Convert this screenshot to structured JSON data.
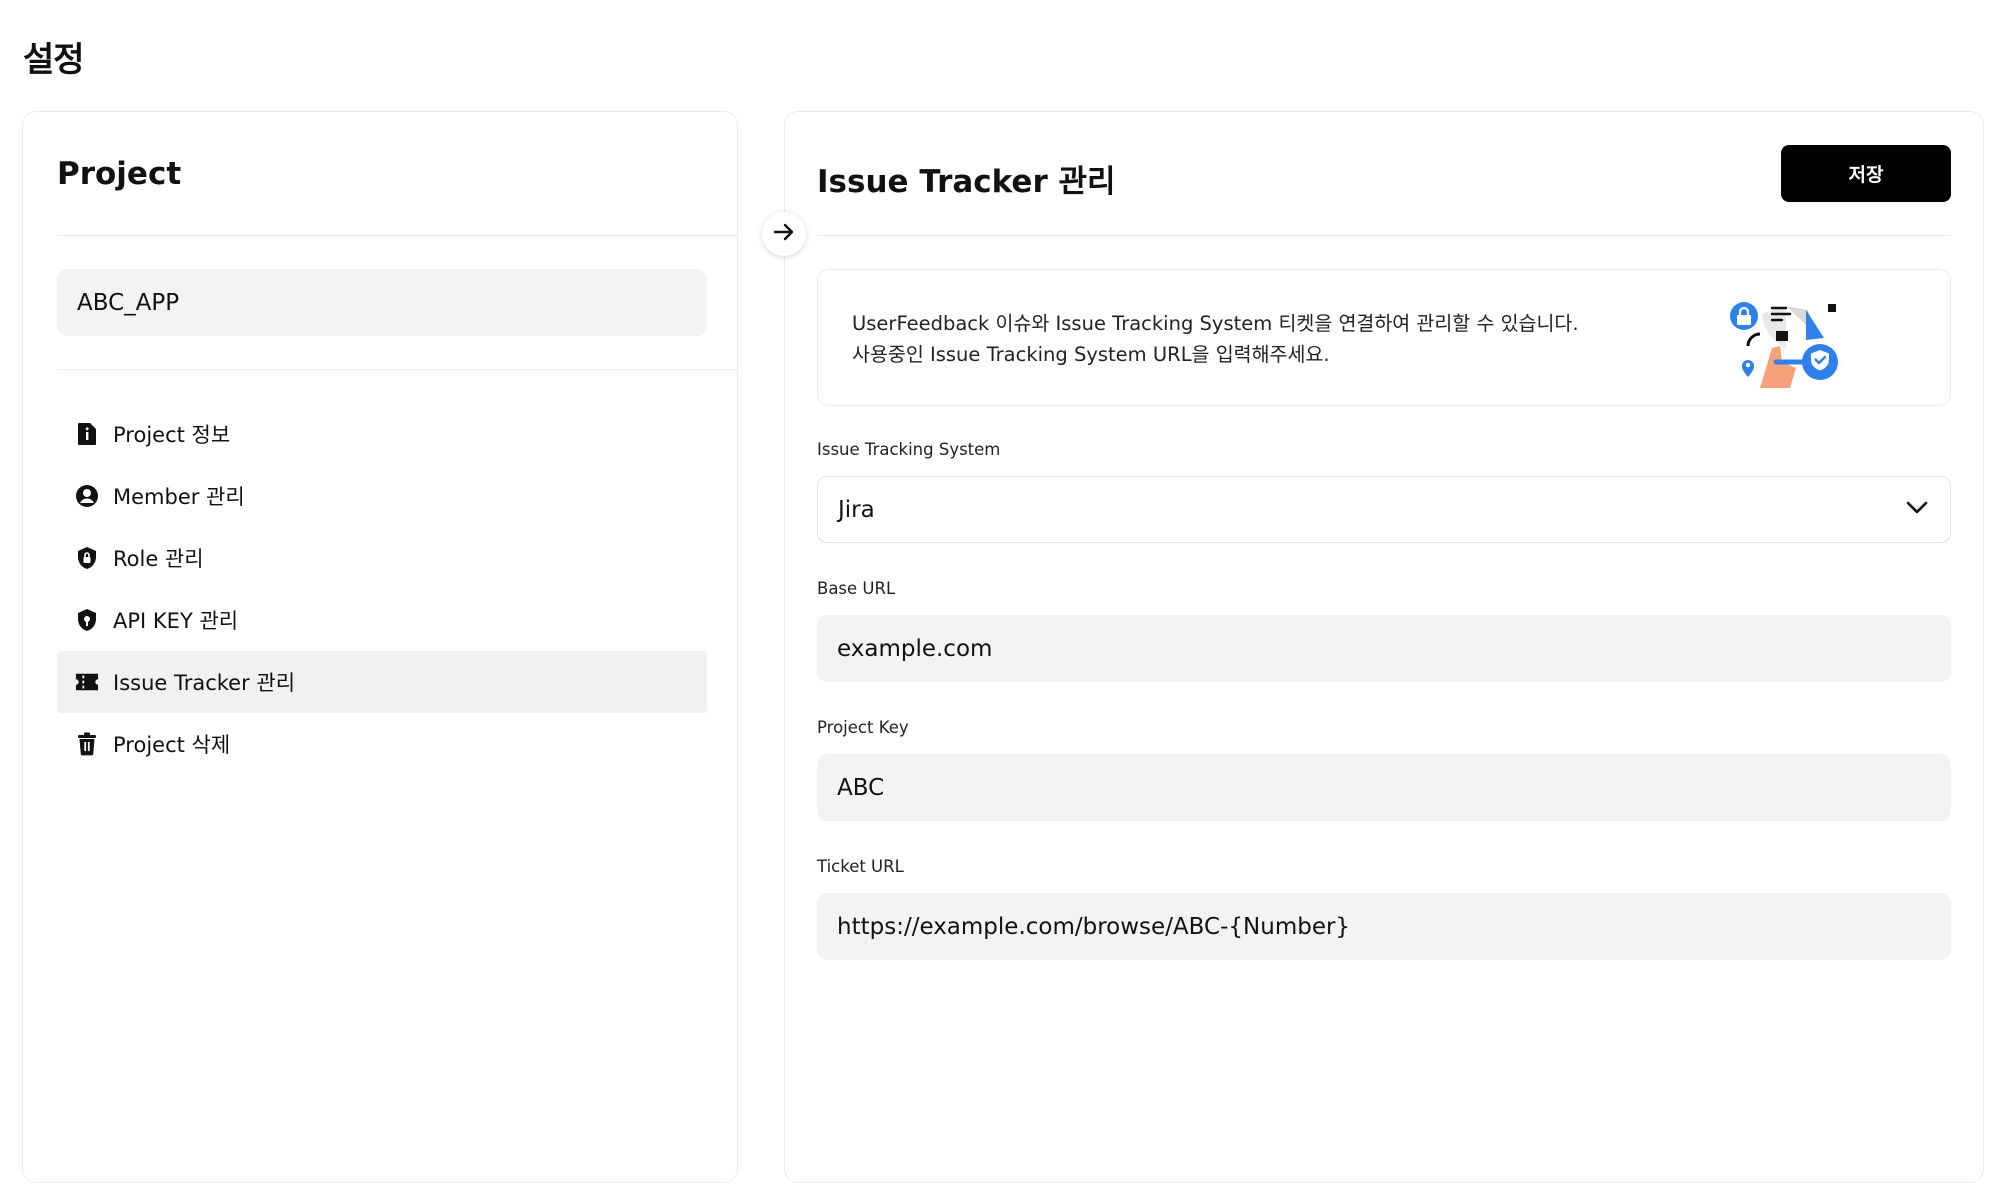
{
  "page": {
    "title": "설정"
  },
  "left_panel": {
    "title": "Project",
    "selected_project": "ABC_APP",
    "menu": [
      {
        "label": "Project 정보",
        "icon": "info-doc-icon",
        "active": false
      },
      {
        "label": "Member 관리",
        "icon": "user-circle-icon",
        "active": false
      },
      {
        "label": "Role 관리",
        "icon": "shield-lock-icon",
        "active": false
      },
      {
        "label": "API KEY 관리",
        "icon": "shield-key-icon",
        "active": false
      },
      {
        "label": "Issue Tracker 관리",
        "icon": "ticket-icon",
        "active": true
      },
      {
        "label": "Project 삭제",
        "icon": "trash-icon",
        "active": false
      }
    ]
  },
  "right_panel": {
    "title": "Issue Tracker 관리",
    "save_label": "저장",
    "info": {
      "line1": "UserFeedback 이슈와 Issue Tracking System 티켓을 연결하여 관리할 수 있습니다.",
      "line2": "사용중인 Issue Tracking System URL을 입력해주세요."
    },
    "fields": {
      "its": {
        "label": "Issue Tracking System",
        "value": "Jira"
      },
      "base_url": {
        "label": "Base URL",
        "value": "example.com"
      },
      "project_key": {
        "label": "Project Key",
        "value": "ABC"
      },
      "ticket_url": {
        "label": "Ticket URL",
        "value": "https://example.com/browse/ABC-{Number}"
      }
    }
  },
  "colors": {
    "accent": "#000000",
    "illustration_blue": "#2f80ed",
    "skin": "#f7a17a"
  }
}
